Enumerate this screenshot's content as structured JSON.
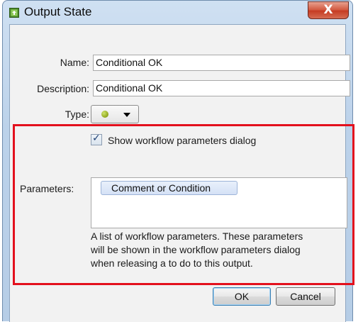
{
  "window": {
    "title": "Output State",
    "close_glyph": "X",
    "icon": "output-state-icon"
  },
  "form": {
    "name_label": "Name:",
    "name_value": "Conditional OK",
    "description_label": "Description:",
    "description_value": "Conditional OK",
    "type_label": "Type:",
    "type_color": "#9ab320"
  },
  "workflow": {
    "show_dialog_checked": true,
    "check_glyph": "✓",
    "show_dialog_label": "Show workflow parameters dialog",
    "parameters_label": "Parameters:",
    "parameters": [
      "Comment or Condition"
    ],
    "help_lines": [
      "A list of workflow parameters. These parameters",
      "will be shown in the workflow parameters dialog",
      "when releasing a to do to this output."
    ]
  },
  "buttons": {
    "ok_label": "OK",
    "cancel_label": "Cancel"
  },
  "highlight_color": "#e3101d"
}
